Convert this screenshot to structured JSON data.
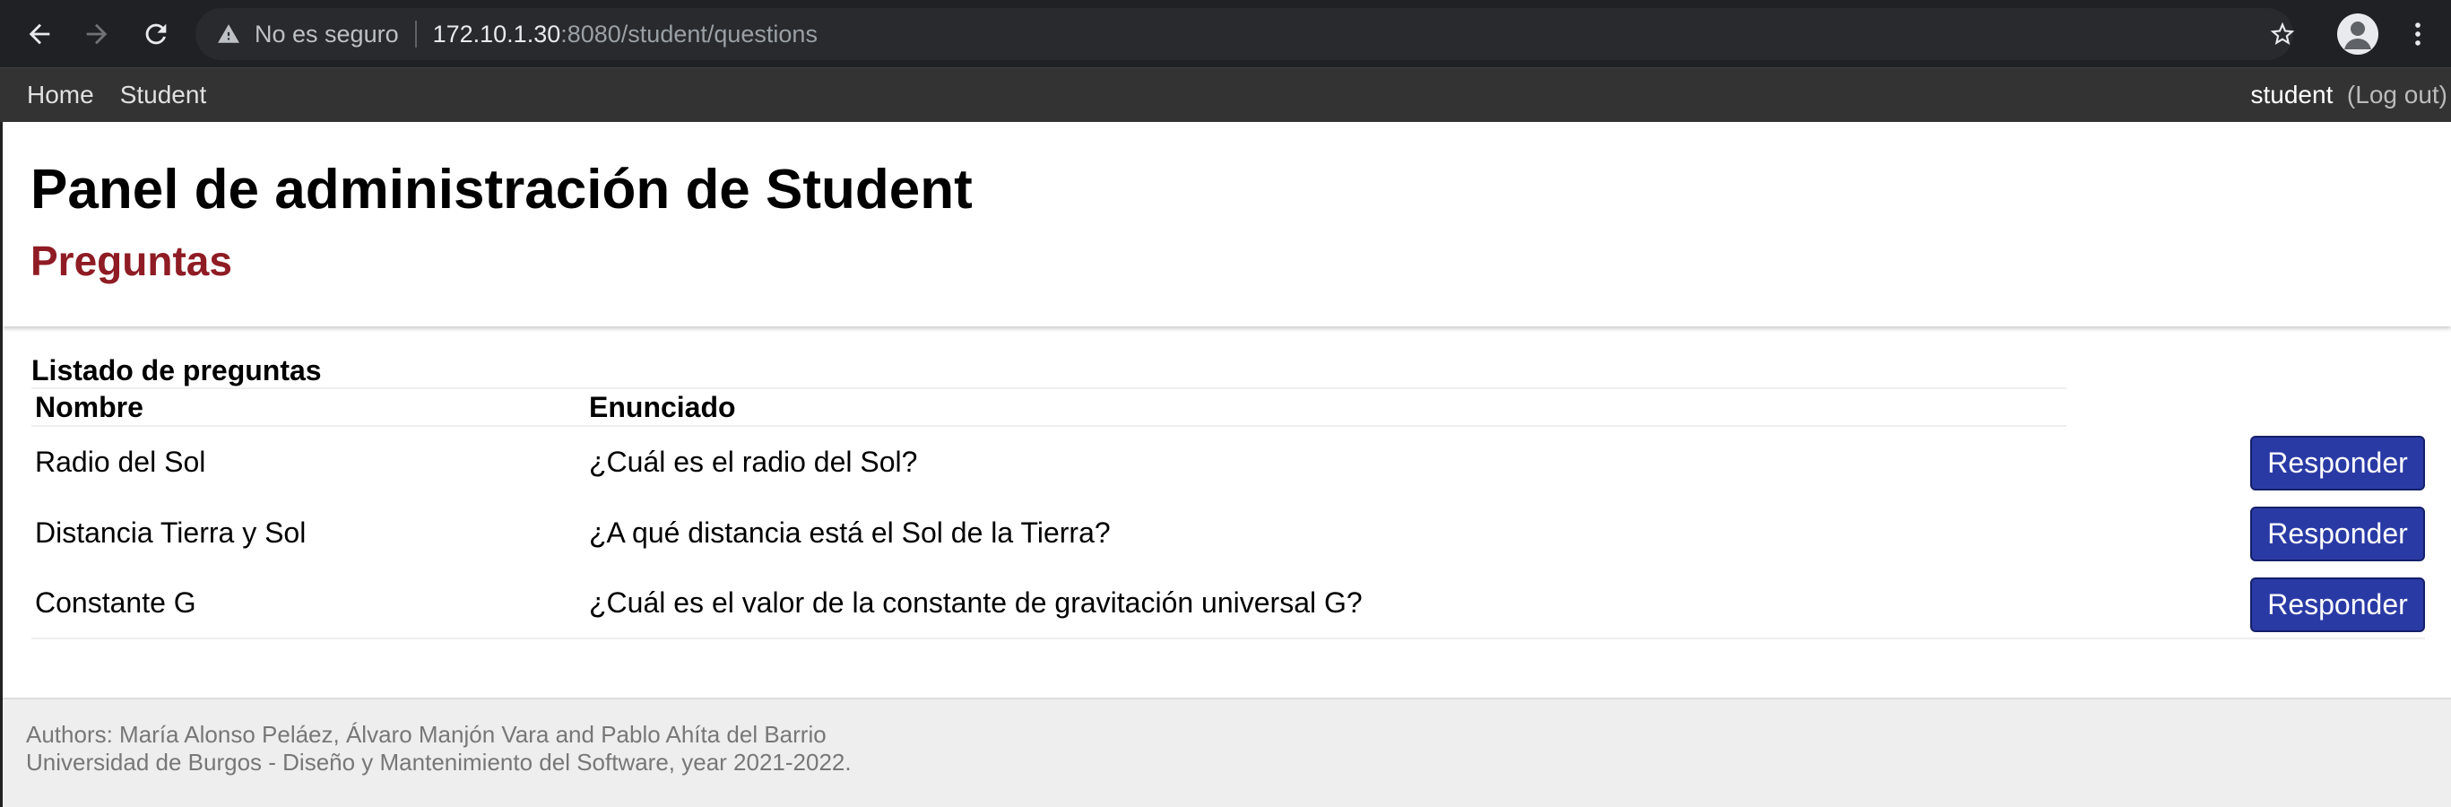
{
  "browser": {
    "security_label": "No es seguro",
    "url_host": "172.10.1.30",
    "url_path": ":8080/student/questions"
  },
  "nav": {
    "links": [
      "Home",
      "Student"
    ],
    "username": "student",
    "logout_open": "(",
    "logout_label": "Log out",
    "logout_close": ")"
  },
  "header": {
    "title": "Panel de administración de Student",
    "subtitle": "Preguntas"
  },
  "table": {
    "caption": "Listado de preguntas",
    "columns": [
      "Nombre",
      "Enunciado"
    ],
    "rows": [
      {
        "nombre": "Radio del Sol",
        "enunciado": "¿Cuál es el radio del Sol?",
        "action": "Responder"
      },
      {
        "nombre": "Distancia Tierra y Sol",
        "enunciado": "¿A qué distancia está el Sol de la Tierra?",
        "action": "Responder"
      },
      {
        "nombre": "Constante G",
        "enunciado": "¿Cuál es el valor de la constante de gravitación universal G?",
        "action": "Responder"
      }
    ]
  },
  "footer": {
    "authors": "Authors: María Alonso Peláez, Álvaro Manjón Vara and Pablo Ahíta del Barrio",
    "university": "Universidad de Burgos - Diseño y Mantenimiento del Software, year 2021-2022."
  },
  "colors": {
    "subtitle": "#8f1c24",
    "button": "#2a3aa5",
    "nav_bg": "#333333",
    "footer_bg": "#eeeeee"
  }
}
